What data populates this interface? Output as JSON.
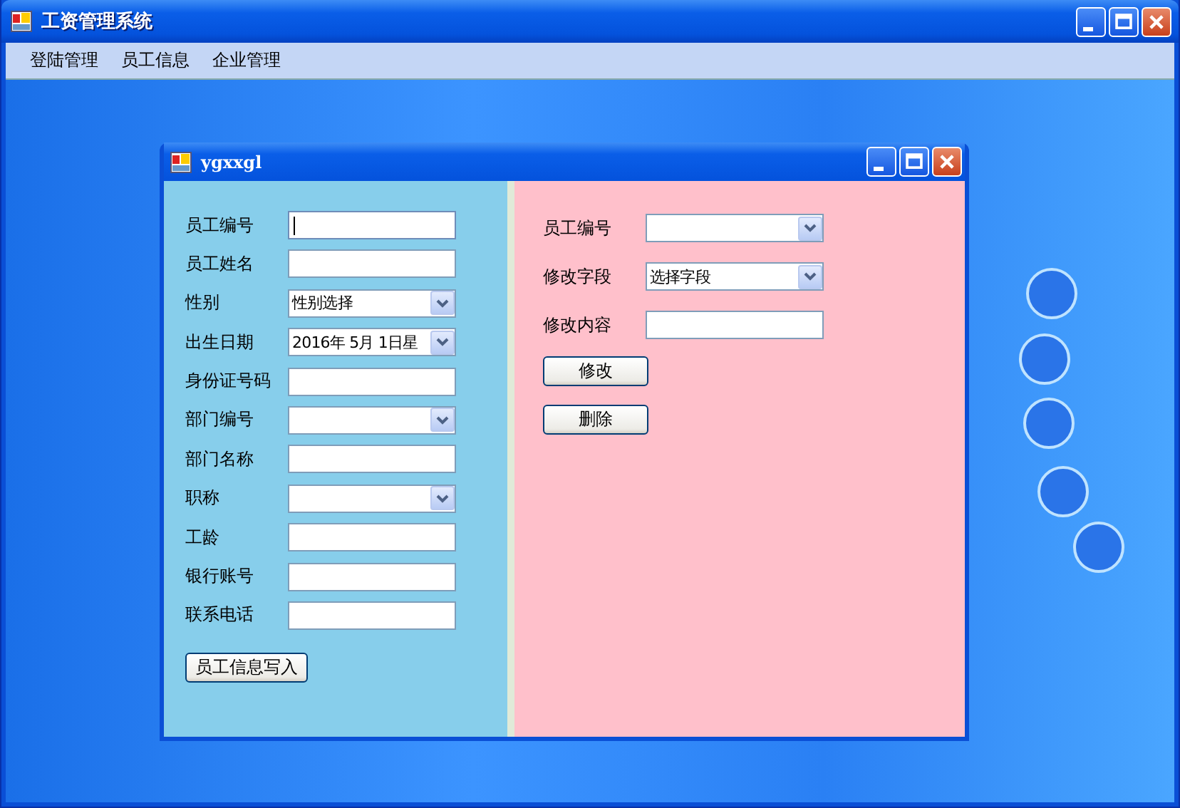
{
  "window": {
    "title": "工资管理系统"
  },
  "menu": [
    "登陆管理",
    "员工信息",
    "企业管理"
  ],
  "child_window": {
    "title": "ygxxgl",
    "left_form": {
      "fields": [
        {
          "label": "员工编号",
          "kind": "text",
          "focused": true
        },
        {
          "label": "员工姓名",
          "kind": "text",
          "focused": false
        },
        {
          "label": "性别",
          "kind": "combo",
          "value": "性别选择",
          "focused": false
        },
        {
          "label": "出生日期",
          "kind": "combo",
          "value": "2016年 5月 1日星",
          "focused": false
        },
        {
          "label": "身份证号码",
          "kind": "text",
          "focused": false
        },
        {
          "label": "部门编号",
          "kind": "combo",
          "focused": false
        },
        {
          "label": "部门名称",
          "kind": "text",
          "focused": false
        },
        {
          "label": "职称",
          "kind": "combo",
          "focused": false
        },
        {
          "label": "工龄",
          "kind": "text",
          "focused": false
        },
        {
          "label": "银行账号",
          "kind": "text",
          "focused": false
        },
        {
          "label": "联系电话",
          "kind": "text",
          "focused": false
        }
      ],
      "buttons": [
        "员工信息写入"
      ]
    },
    "right_form": {
      "fields": [
        {
          "label": "员工编号",
          "kind": "combo",
          "focused": false
        },
        {
          "label": "修改字段",
          "kind": "combo",
          "value": "选择字段",
          "focused": false
        },
        {
          "label": "修改内容",
          "kind": "text",
          "focused": false
        }
      ],
      "buttons": [
        "修改",
        "删除"
      ]
    }
  }
}
